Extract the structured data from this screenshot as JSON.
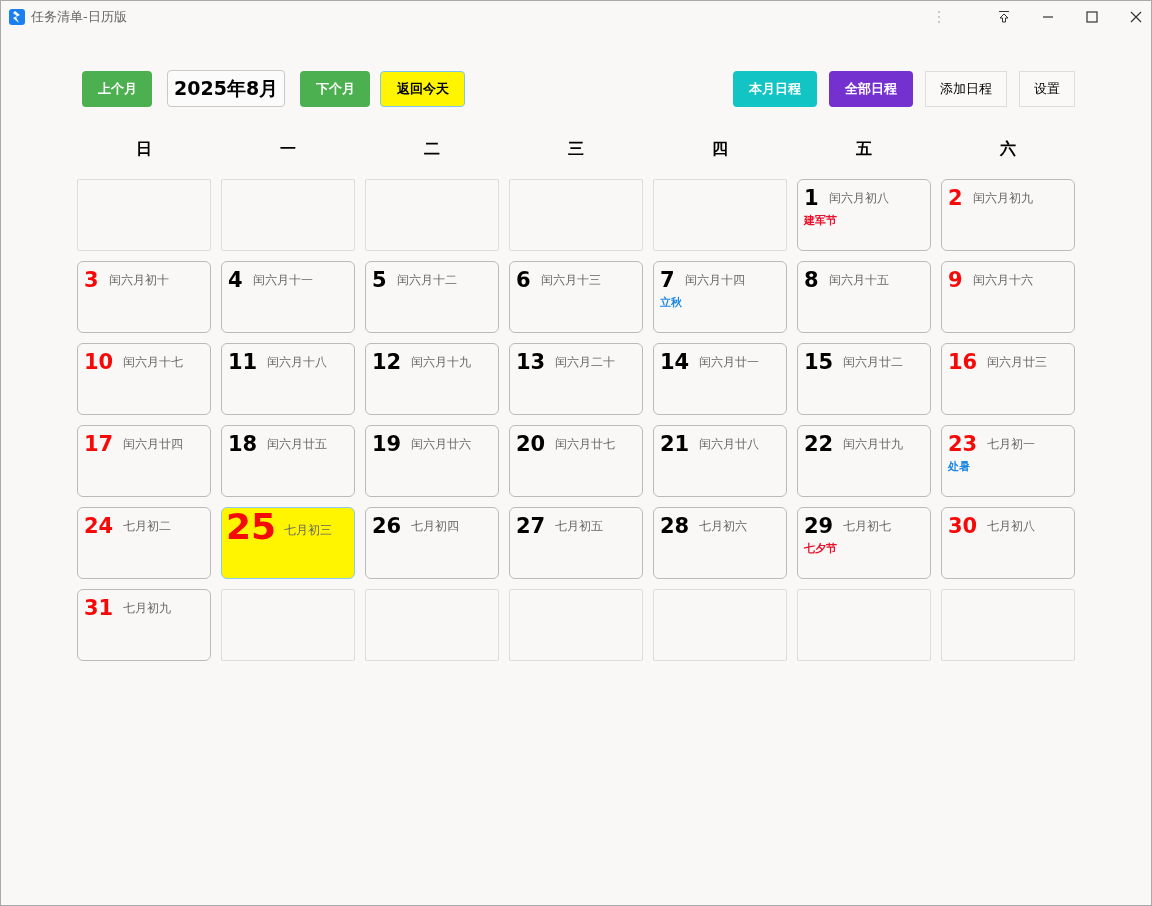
{
  "window": {
    "title": "任务清单-日历版"
  },
  "toolbar": {
    "left": [
      {
        "kind": "nav",
        "label": "上个月"
      },
      {
        "kind": "month",
        "label": "2025年8月"
      },
      {
        "kind": "nav",
        "label": "下个月"
      },
      {
        "kind": "today",
        "label": "返回今天"
      }
    ],
    "right": [
      {
        "kind": "teal",
        "label": "本月日程"
      },
      {
        "kind": "purple",
        "label": "全部日程"
      },
      {
        "kind": "plain",
        "label": "添加日程"
      },
      {
        "kind": "plain",
        "label": "设置"
      }
    ]
  },
  "weekdays": [
    "日",
    "一",
    "二",
    "三",
    "四",
    "五",
    "六"
  ],
  "cells": [
    {
      "kind": "blank"
    },
    {
      "kind": "blank"
    },
    {
      "kind": "blank"
    },
    {
      "kind": "blank"
    },
    {
      "kind": "blank"
    },
    {
      "kind": "day",
      "day": "1",
      "lunar": "闰六月初八",
      "weekend": false,
      "selected": false,
      "festival": {
        "text": "建军节",
        "color": "#e8112d"
      }
    },
    {
      "kind": "day",
      "day": "2",
      "lunar": "闰六月初九",
      "weekend": true,
      "selected": false
    },
    {
      "kind": "day",
      "day": "3",
      "lunar": "闰六月初十",
      "weekend": true,
      "selected": false
    },
    {
      "kind": "day",
      "day": "4",
      "lunar": "闰六月十一",
      "weekend": false,
      "selected": false
    },
    {
      "kind": "day",
      "day": "5",
      "lunar": "闰六月十二",
      "weekend": false,
      "selected": false
    },
    {
      "kind": "day",
      "day": "6",
      "lunar": "闰六月十三",
      "weekend": false,
      "selected": false
    },
    {
      "kind": "day",
      "day": "7",
      "lunar": "闰六月十四",
      "weekend": false,
      "selected": false,
      "festival": {
        "text": "立秋",
        "color": "#1e88e5"
      }
    },
    {
      "kind": "day",
      "day": "8",
      "lunar": "闰六月十五",
      "weekend": false,
      "selected": false
    },
    {
      "kind": "day",
      "day": "9",
      "lunar": "闰六月十六",
      "weekend": true,
      "selected": false
    },
    {
      "kind": "day",
      "day": "10",
      "lunar": "闰六月十七",
      "weekend": true,
      "selected": false
    },
    {
      "kind": "day",
      "day": "11",
      "lunar": "闰六月十八",
      "weekend": false,
      "selected": false
    },
    {
      "kind": "day",
      "day": "12",
      "lunar": "闰六月十九",
      "weekend": false,
      "selected": false
    },
    {
      "kind": "day",
      "day": "13",
      "lunar": "闰六月二十",
      "weekend": false,
      "selected": false
    },
    {
      "kind": "day",
      "day": "14",
      "lunar": "闰六月廿一",
      "weekend": false,
      "selected": false
    },
    {
      "kind": "day",
      "day": "15",
      "lunar": "闰六月廿二",
      "weekend": false,
      "selected": false
    },
    {
      "kind": "day",
      "day": "16",
      "lunar": "闰六月廿三",
      "weekend": true,
      "selected": false
    },
    {
      "kind": "day",
      "day": "17",
      "lunar": "闰六月廿四",
      "weekend": true,
      "selected": false
    },
    {
      "kind": "day",
      "day": "18",
      "lunar": "闰六月廿五",
      "weekend": false,
      "selected": false
    },
    {
      "kind": "day",
      "day": "19",
      "lunar": "闰六月廿六",
      "weekend": false,
      "selected": false
    },
    {
      "kind": "day",
      "day": "20",
      "lunar": "闰六月廿七",
      "weekend": false,
      "selected": false
    },
    {
      "kind": "day",
      "day": "21",
      "lunar": "闰六月廿八",
      "weekend": false,
      "selected": false
    },
    {
      "kind": "day",
      "day": "22",
      "lunar": "闰六月廿九",
      "weekend": false,
      "selected": false
    },
    {
      "kind": "day",
      "day": "23",
      "lunar": "七月初一",
      "weekend": true,
      "selected": false,
      "festival": {
        "text": "处暑",
        "color": "#1e88e5"
      }
    },
    {
      "kind": "day",
      "day": "24",
      "lunar": "七月初二",
      "weekend": true,
      "selected": false
    },
    {
      "kind": "day",
      "day": "25",
      "lunar": "七月初三",
      "weekend": false,
      "selected": true
    },
    {
      "kind": "day",
      "day": "26",
      "lunar": "七月初四",
      "weekend": false,
      "selected": false
    },
    {
      "kind": "day",
      "day": "27",
      "lunar": "七月初五",
      "weekend": false,
      "selected": false
    },
    {
      "kind": "day",
      "day": "28",
      "lunar": "七月初六",
      "weekend": false,
      "selected": false
    },
    {
      "kind": "day",
      "day": "29",
      "lunar": "七月初七",
      "weekend": false,
      "selected": false,
      "festival": {
        "text": "七夕节",
        "color": "#e8112d"
      }
    },
    {
      "kind": "day",
      "day": "30",
      "lunar": "七月初八",
      "weekend": true,
      "selected": false
    },
    {
      "kind": "day",
      "day": "31",
      "lunar": "七月初九",
      "weekend": true,
      "selected": false
    },
    {
      "kind": "blank"
    },
    {
      "kind": "blank"
    },
    {
      "kind": "blank"
    },
    {
      "kind": "blank"
    },
    {
      "kind": "blank"
    },
    {
      "kind": "blank"
    }
  ]
}
